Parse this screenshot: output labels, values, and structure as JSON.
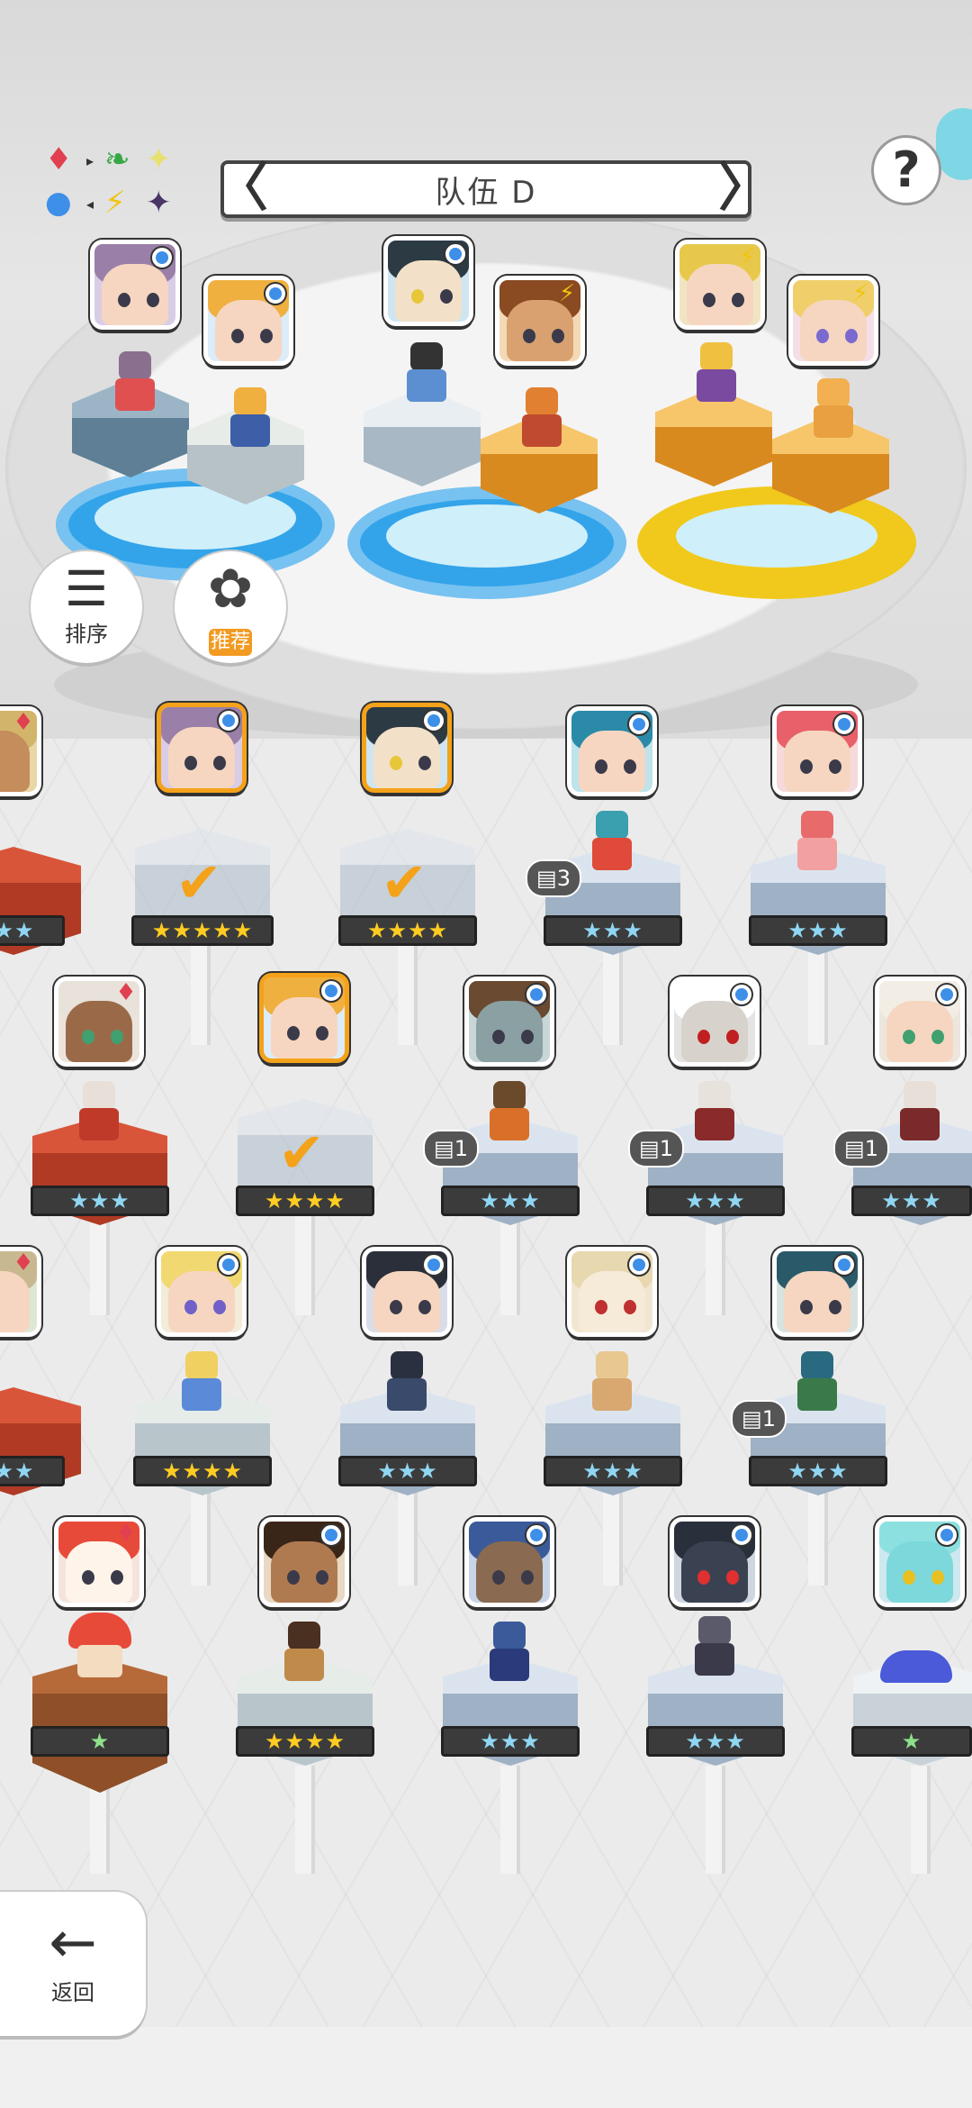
{
  "header": {
    "team_title": "队伍 D",
    "prev_arrow": "〈",
    "next_arrow": "〉",
    "help_label": "?"
  },
  "element_key": {
    "symbols": [
      "♦",
      "➤",
      "⚡",
      "✦"
    ],
    "colors": [
      "#e04050",
      "#36a845",
      "#f1c40f",
      "#4a3566",
      "#3d8fe8"
    ]
  },
  "controls": {
    "sort_label": "排序",
    "sort_icon": "sort-descending-icon",
    "recommend_label": "推荐",
    "recommend_icon": "mushroom-cluster-icon",
    "back_label": "返回",
    "back_icon": "arrow-left-icon"
  },
  "team_slots": [
    {
      "slot": 1,
      "pad_color": "#33a4ea",
      "members": [
        "purple-hair-girl",
        "blonde-boy"
      ]
    },
    {
      "slot": 2,
      "pad_color": "#33a4ea",
      "members": [
        "masked-swordsman",
        "glasses-girl"
      ]
    },
    {
      "slot": 3,
      "pad_color": "#f0c91c",
      "members": [
        "cat-eared-mage",
        "blonde-princess"
      ]
    }
  ],
  "roster": [
    {
      "row": 1,
      "units": [
        {
          "element": "fire",
          "stars": "★★",
          "selected": false
        },
        {
          "element": "water",
          "stars": "★★★★★",
          "selected": true
        },
        {
          "element": "water",
          "stars": "★★★★",
          "selected": true
        },
        {
          "element": "water",
          "stars": "★★★",
          "selected": false,
          "duplicates": "3"
        },
        {
          "element": "water",
          "stars": "★★★",
          "selected": false
        }
      ]
    },
    {
      "row": 2,
      "units": [
        {
          "element": "fire",
          "stars": "★★★",
          "selected": false
        },
        {
          "element": "water",
          "stars": "★★★★",
          "selected": true
        },
        {
          "element": "water",
          "stars": "★★★",
          "selected": false,
          "duplicates": "1"
        },
        {
          "element": "water",
          "stars": "★★★",
          "selected": false,
          "duplicates": "1"
        },
        {
          "element": "water",
          "stars": "★★★",
          "selected": false,
          "duplicates": "1"
        }
      ]
    },
    {
      "row": 3,
      "units": [
        {
          "element": "fire",
          "stars": "★★",
          "selected": false
        },
        {
          "element": "water",
          "stars": "★★★★",
          "selected": false
        },
        {
          "element": "water",
          "stars": "★★★",
          "selected": false
        },
        {
          "element": "water",
          "stars": "★★★",
          "selected": false
        },
        {
          "element": "water",
          "stars": "★★★",
          "selected": false,
          "duplicates": "1"
        }
      ]
    },
    {
      "row": 4,
      "units": [
        {
          "element": "fire",
          "stars": "★",
          "selected": false
        },
        {
          "element": "water",
          "stars": "★★★★",
          "selected": false
        },
        {
          "element": "water",
          "stars": "★★★",
          "selected": false
        },
        {
          "element": "water",
          "stars": "★★★",
          "selected": false
        },
        {
          "element": "water",
          "stars": "★",
          "selected": false
        }
      ]
    }
  ],
  "dup_icon": "card-stack-icon",
  "check_symbol": "✔"
}
